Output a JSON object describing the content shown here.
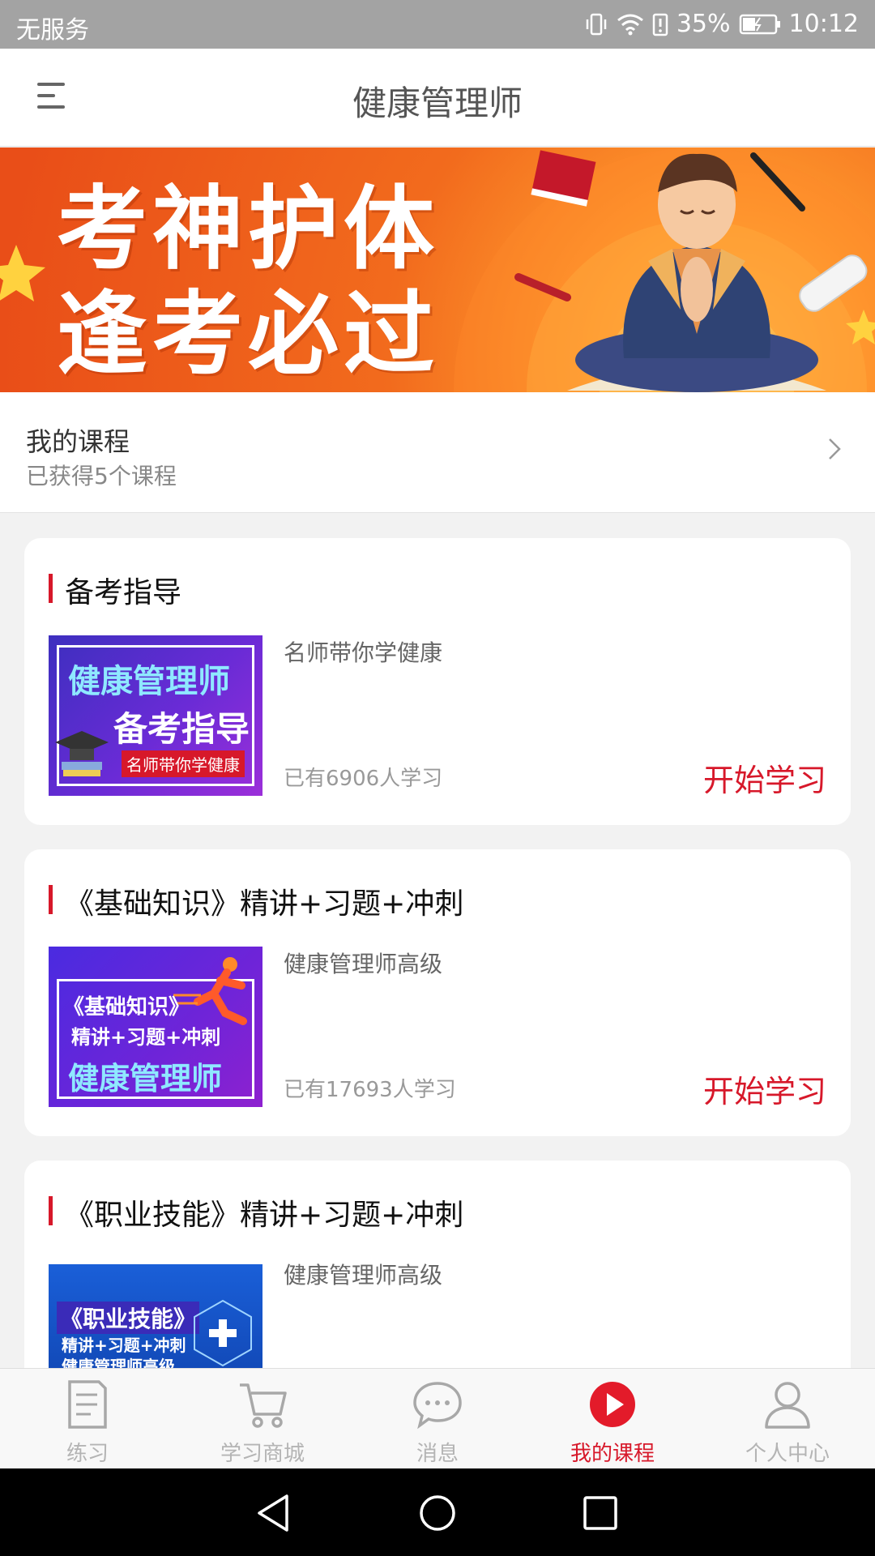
{
  "status_bar": {
    "carrier": "无服务",
    "battery": "35%",
    "time": "10:12",
    "icons": [
      "vibrate-icon",
      "wifi-icon",
      "battery-alert-icon",
      "battery-charging-icon"
    ]
  },
  "header": {
    "title": "健康管理师",
    "menu_icon": "hamburger-menu-icon"
  },
  "banner": {
    "line1": "考神护体",
    "line2": "逢考必过"
  },
  "my_courses": {
    "title": "我的课程",
    "subtitle": "已获得5个课程"
  },
  "courses": [
    {
      "title": "备考指导",
      "subtitle": "名师带你学健康",
      "learners": "已有6906人学习",
      "action": "开始学习",
      "thumb": {
        "line1": "健康管理师",
        "line2": "备考指导",
        "line3": "名师带你学健康"
      }
    },
    {
      "title": "《基础知识》精讲+习题+冲刺",
      "subtitle": "健康管理师高级",
      "learners": "已有17693人学习",
      "action": "开始学习",
      "thumb": {
        "line1": "《基础知识》",
        "line2": "精讲+习题+冲刺",
        "line3": "健康管理师"
      }
    },
    {
      "title": "《职业技能》精讲+习题+冲刺",
      "subtitle": "健康管理师高级",
      "thumb": {
        "line1": "《职业技能》",
        "line2": "精讲+习题+冲刺",
        "line3": "健康管理师高级"
      }
    }
  ],
  "bottom_nav": {
    "items": [
      {
        "label": "练习",
        "icon": "notebook-icon"
      },
      {
        "label": "学习商城",
        "icon": "cart-icon"
      },
      {
        "label": "消息",
        "icon": "chat-bubble-icon"
      },
      {
        "label": "我的课程",
        "icon": "play-circle-icon"
      },
      {
        "label": "个人中心",
        "icon": "user-icon"
      }
    ],
    "active": "我的课程"
  },
  "colors": {
    "accent": "#d7182a",
    "status_bar": "#a3a3a3",
    "banner": "#f26b1d"
  }
}
